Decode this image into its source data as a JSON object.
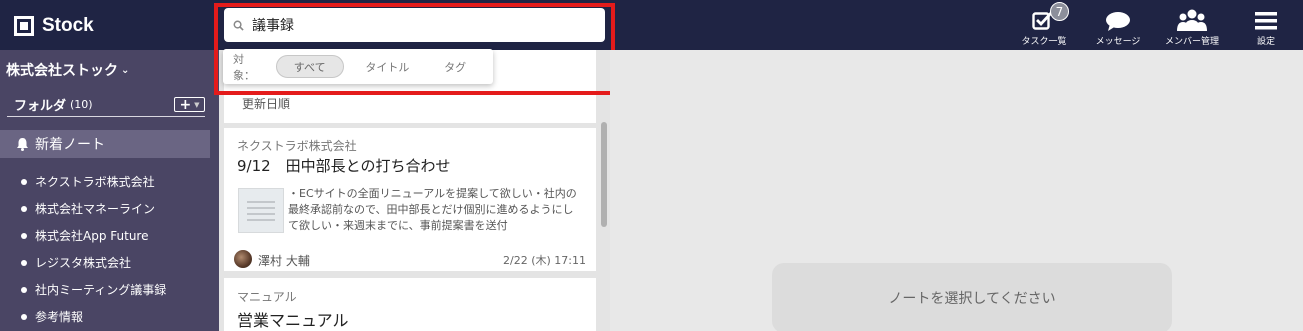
{
  "app": {
    "name": "Stock"
  },
  "search": {
    "value": "議事録",
    "placeholder": ""
  },
  "filter": {
    "label": "対象：",
    "options": [
      "すべて",
      "タイトル",
      "タグ"
    ],
    "selected": "すべて"
  },
  "nav": [
    {
      "icon": "task-check-icon",
      "label": "タスク一覧",
      "badge": "7"
    },
    {
      "icon": "message-bubble-icon",
      "label": "メッセージ"
    },
    {
      "icon": "members-icon",
      "label": "メンバー管理"
    },
    {
      "icon": "hamburger-menu-icon",
      "label": "設定"
    }
  ],
  "sidebar": {
    "company": "株式会社ストック",
    "folder_title": "フォルダ",
    "folder_count": "(10)",
    "new_notes": "新着ノート",
    "folders": [
      "ネクストラボ株式会社",
      "株式会社マネーライン",
      "株式会社App Future",
      "レジスタ株式会社",
      "社内ミーティング議事録",
      "参考情報"
    ]
  },
  "note_list": {
    "sort_label": "更新日順",
    "notes": [
      {
        "company": "ネクストラボ株式会社",
        "title": "9/12　田中部長との打ち合わせ",
        "excerpt": "・ECサイトの全面リニューアルを提案して欲しい・社内の最終承認前なので、田中部長とだけ個別に進めるようにして欲しい・来週末までに、事前提案書を送付",
        "author": "澤村 大輔",
        "date": "2/22 (木) 17:11"
      },
      {
        "company": "マニュアル",
        "title": "営業マニュアル"
      }
    ]
  },
  "main": {
    "empty_message": "ノートを選択してください"
  },
  "colors": {
    "header": "#1f2444",
    "sidebar": "#4a4564",
    "highlight": "#e41b1b"
  }
}
